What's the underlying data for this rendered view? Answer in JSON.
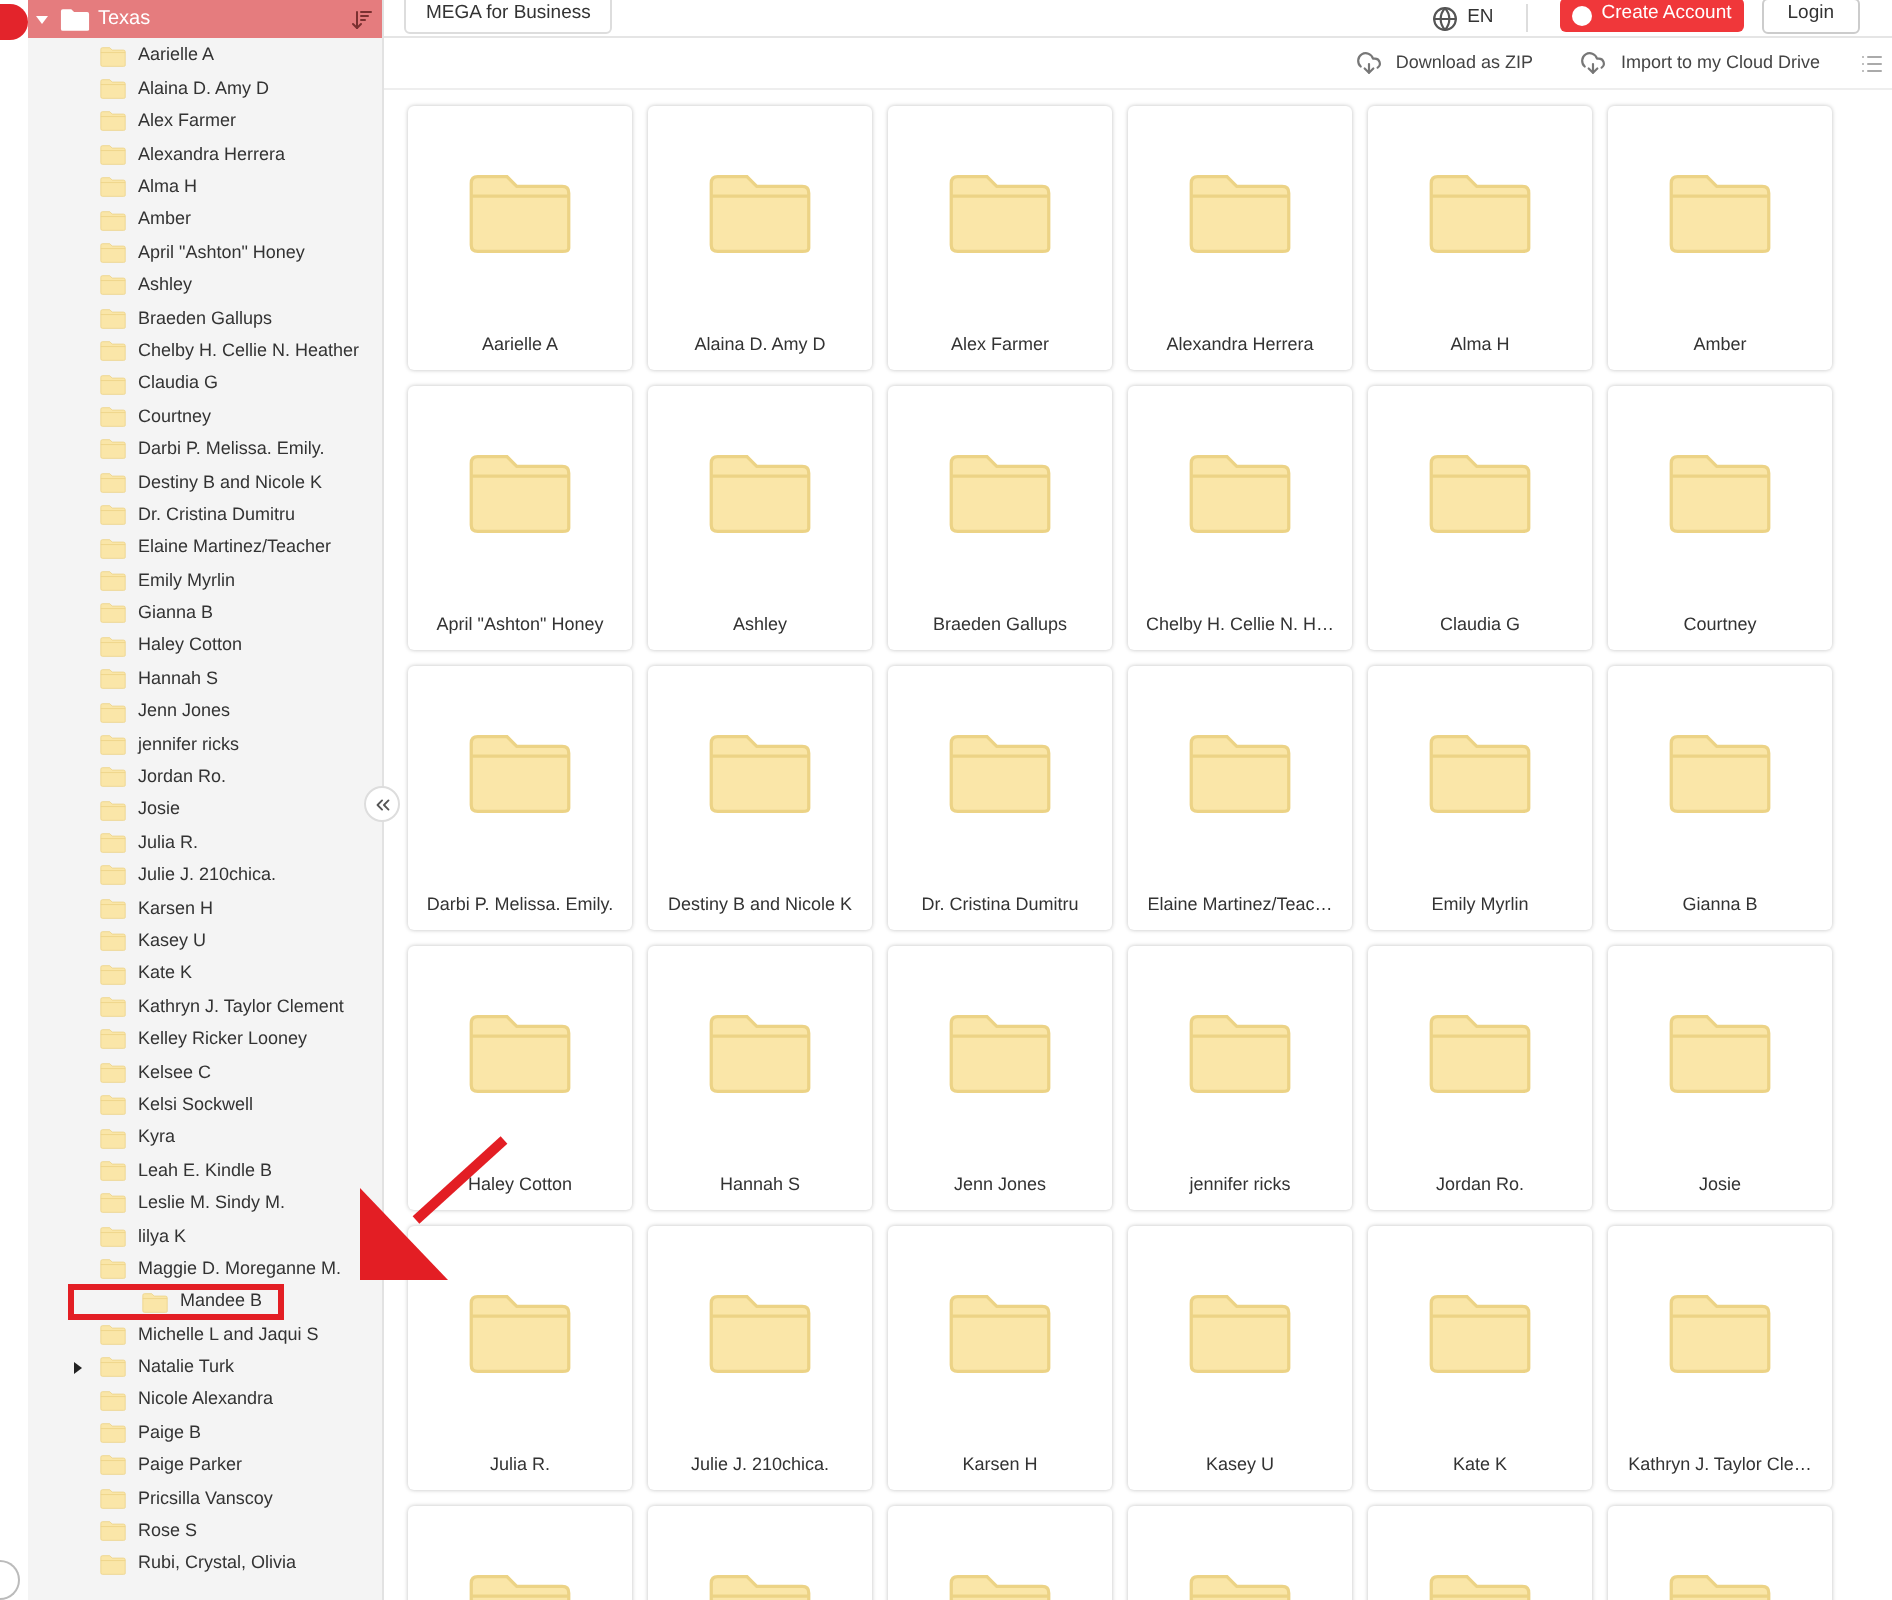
{
  "topbar": {
    "business_button": "MEGA for Business",
    "language": "EN",
    "create_account": "Create Account",
    "login": "Login"
  },
  "toolbar": {
    "download": "Download as ZIP",
    "import": "Import to my Cloud Drive"
  },
  "sidebar": {
    "root": {
      "label": "Texas",
      "expanded": true
    },
    "items": [
      {
        "label": "Aarielle A",
        "expandable": false,
        "highlighted": false
      },
      {
        "label": "Alaina D. Amy D",
        "expandable": false,
        "highlighted": false
      },
      {
        "label": "Alex Farmer",
        "expandable": false,
        "highlighted": false
      },
      {
        "label": "Alexandra Herrera",
        "expandable": false,
        "highlighted": false
      },
      {
        "label": "Alma H",
        "expandable": false,
        "highlighted": false
      },
      {
        "label": "Amber",
        "expandable": false,
        "highlighted": false
      },
      {
        "label": "April \"Ashton\" Honey",
        "expandable": false,
        "highlighted": false
      },
      {
        "label": "Ashley",
        "expandable": false,
        "highlighted": false
      },
      {
        "label": "Braeden Gallups",
        "expandable": false,
        "highlighted": false
      },
      {
        "label": "Chelby H. Cellie N. Heather",
        "expandable": false,
        "highlighted": false
      },
      {
        "label": "Claudia G",
        "expandable": false,
        "highlighted": false
      },
      {
        "label": "Courtney",
        "expandable": false,
        "highlighted": false
      },
      {
        "label": "Darbi P. Melissa. Emily.",
        "expandable": false,
        "highlighted": false
      },
      {
        "label": "Destiny B and Nicole K",
        "expandable": false,
        "highlighted": false
      },
      {
        "label": "Dr. Cristina Dumitru",
        "expandable": false,
        "highlighted": false
      },
      {
        "label": "Elaine Martinez/Teacher",
        "expandable": false,
        "highlighted": false
      },
      {
        "label": "Emily Myrlin",
        "expandable": false,
        "highlighted": false
      },
      {
        "label": "Gianna B",
        "expandable": false,
        "highlighted": false
      },
      {
        "label": "Haley Cotton",
        "expandable": false,
        "highlighted": false
      },
      {
        "label": "Hannah S",
        "expandable": false,
        "highlighted": false
      },
      {
        "label": "Jenn Jones",
        "expandable": false,
        "highlighted": false
      },
      {
        "label": "jennifer ricks",
        "expandable": false,
        "highlighted": false
      },
      {
        "label": "Jordan Ro.",
        "expandable": false,
        "highlighted": false
      },
      {
        "label": "Josie",
        "expandable": false,
        "highlighted": false
      },
      {
        "label": "Julia R.",
        "expandable": false,
        "highlighted": false
      },
      {
        "label": "Julie J. 210chica.",
        "expandable": false,
        "highlighted": false
      },
      {
        "label": "Karsen H",
        "expandable": false,
        "highlighted": false
      },
      {
        "label": "Kasey U",
        "expandable": false,
        "highlighted": false
      },
      {
        "label": "Kate K",
        "expandable": false,
        "highlighted": false
      },
      {
        "label": "Kathryn J. Taylor Clement",
        "expandable": false,
        "highlighted": false
      },
      {
        "label": "Kelley Ricker Looney",
        "expandable": false,
        "highlighted": false
      },
      {
        "label": "Kelsee C",
        "expandable": false,
        "highlighted": false
      },
      {
        "label": "Kelsi Sockwell",
        "expandable": false,
        "highlighted": false
      },
      {
        "label": "Kyra",
        "expandable": false,
        "highlighted": false
      },
      {
        "label": "Leah E. Kindle B",
        "expandable": false,
        "highlighted": false
      },
      {
        "label": "Leslie M. Sindy M.",
        "expandable": false,
        "highlighted": false
      },
      {
        "label": "lilya K",
        "expandable": false,
        "highlighted": false
      },
      {
        "label": "Maggie D. Moreganne M.",
        "expandable": false,
        "highlighted": false
      },
      {
        "label": "Mandee B",
        "expandable": false,
        "highlighted": true
      },
      {
        "label": "Michelle L and Jaqui S",
        "expandable": false,
        "highlighted": false
      },
      {
        "label": "Natalie Turk",
        "expandable": true,
        "highlighted": false
      },
      {
        "label": "Nicole Alexandra",
        "expandable": false,
        "highlighted": false
      },
      {
        "label": "Paige B",
        "expandable": false,
        "highlighted": false
      },
      {
        "label": "Paige Parker",
        "expandable": false,
        "highlighted": false
      },
      {
        "label": "Pricsilla Vanscoy",
        "expandable": false,
        "highlighted": false
      },
      {
        "label": "Rose S",
        "expandable": false,
        "highlighted": false
      },
      {
        "label": "Rubi, Crystal, Olivia",
        "expandable": false,
        "highlighted": false
      }
    ]
  },
  "grid": {
    "tiles": [
      {
        "kind": "folder",
        "label": "Aarielle A"
      },
      {
        "kind": "folder",
        "label": "Alaina D. Amy D"
      },
      {
        "kind": "folder",
        "label": "Alex Farmer"
      },
      {
        "kind": "folder",
        "label": "Alexandra Herrera"
      },
      {
        "kind": "folder",
        "label": "Alma H"
      },
      {
        "kind": "folder",
        "label": "Amber"
      },
      {
        "kind": "folder",
        "label": "April \"Ashton\" Honey"
      },
      {
        "kind": "folder",
        "label": "Ashley"
      },
      {
        "kind": "folder",
        "label": "Braeden Gallups"
      },
      {
        "kind": "folder",
        "label": "Chelby H. Cellie N. H…"
      },
      {
        "kind": "folder",
        "label": "Claudia G"
      },
      {
        "kind": "folder",
        "label": "Courtney"
      },
      {
        "kind": "folder",
        "label": "Darbi P. Melissa. Emily."
      },
      {
        "kind": "folder",
        "label": "Destiny B and Nicole K"
      },
      {
        "kind": "folder",
        "label": "Dr. Cristina Dumitru"
      },
      {
        "kind": "folder",
        "label": "Elaine Martinez/Teac…"
      },
      {
        "kind": "folder",
        "label": "Emily Myrlin"
      },
      {
        "kind": "folder",
        "label": "Gianna B"
      },
      {
        "kind": "folder",
        "label": "Haley Cotton"
      },
      {
        "kind": "folder",
        "label": "Hannah S"
      },
      {
        "kind": "folder",
        "label": "Jenn Jones"
      },
      {
        "kind": "folder",
        "label": "jennifer ricks"
      },
      {
        "kind": "folder",
        "label": "Jordan Ro."
      },
      {
        "kind": "folder",
        "label": "Josie"
      },
      {
        "kind": "folder",
        "label": "Julia R."
      },
      {
        "kind": "folder",
        "label": "Julie J. 210chica."
      },
      {
        "kind": "folder",
        "label": "Karsen H"
      },
      {
        "kind": "folder",
        "label": "Kasey U"
      },
      {
        "kind": "folder",
        "label": "Kate K"
      },
      {
        "kind": "folder",
        "label": "Kathryn J. Taylor Cle…"
      },
      {
        "kind": "folder"
      },
      {
        "kind": "folder"
      },
      {
        "kind": "folder"
      },
      {
        "kind": "folder"
      },
      {
        "kind": "folder"
      },
      {
        "kind": "folder"
      }
    ]
  }
}
